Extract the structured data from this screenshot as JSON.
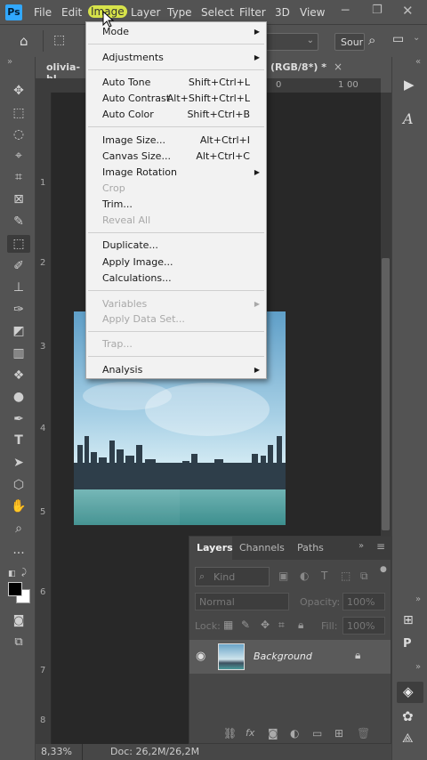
{
  "app": {
    "logo": "Ps"
  },
  "menubar": {
    "items": [
      "File",
      "Edit",
      "Image",
      "Layer",
      "Type",
      "Select",
      "Filter",
      "3D",
      "View"
    ],
    "active_index": 2
  },
  "options": {
    "search_value": "Sour"
  },
  "document": {
    "tab_left": "olivia-bl",
    "tab_right": "(RGB/8*) *",
    "close_glyph": "×"
  },
  "ruler": {
    "top": [
      "0",
      "1",
      "00"
    ],
    "left": [
      "1",
      "2",
      "3",
      "4",
      "5",
      "6",
      "7",
      "8"
    ]
  },
  "menu": {
    "mode": "Mode",
    "adjustments": "Adjustments",
    "auto_tone": "Auto Tone",
    "auto_tone_sc": "Shift+Ctrl+L",
    "auto_contrast": "Auto Contrast",
    "auto_contrast_sc": "Alt+Shift+Ctrl+L",
    "auto_color": "Auto Color",
    "auto_color_sc": "Shift+Ctrl+B",
    "image_size": "Image Size...",
    "image_size_sc": "Alt+Ctrl+I",
    "canvas_size": "Canvas Size...",
    "canvas_size_sc": "Alt+Ctrl+C",
    "image_rotation": "Image Rotation",
    "crop": "Crop",
    "trim": "Trim...",
    "reveal_all": "Reveal All",
    "duplicate": "Duplicate...",
    "apply_image": "Apply Image...",
    "calculations": "Calculations...",
    "variables": "Variables",
    "apply_data_set": "Apply Data Set...",
    "trap": "Trap...",
    "analysis": "Analysis"
  },
  "layers": {
    "tabs": [
      "Layers",
      "Channels",
      "Paths"
    ],
    "filter_kind": "Kind",
    "blend_mode": "Normal",
    "opacity_label": "Opacity:",
    "opacity_value": "100%",
    "lock_label": "Lock:",
    "fill_label": "Fill:",
    "fill_value": "100%",
    "layer_name": "Background"
  },
  "status": {
    "zoom": "8,33%",
    "doc": "Doc: 26,2M/26,2M"
  },
  "colors": {
    "accent_highlight": "#d7e34a",
    "ps_blue": "#31a8ff"
  }
}
